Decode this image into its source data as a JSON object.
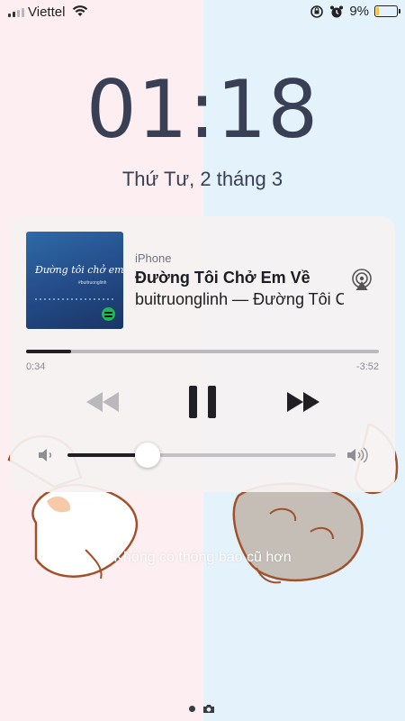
{
  "status_bar": {
    "carrier": "Viettel",
    "battery_percent": "9%",
    "battery_level": 0.09
  },
  "lock_screen": {
    "time": "01:18",
    "date": "Thứ Tư, 2 tháng 3",
    "notifications_text": "Không có thông báo cũ hơn"
  },
  "now_playing": {
    "source": "iPhone",
    "title": "Đường Tôi Chở Em Về",
    "subtitle": "buitruonglinh — Đường Tôi Chở Em Về",
    "elapsed": "0:34",
    "remaining": "-3:52",
    "progress": 0.128,
    "volume": 0.3,
    "artwork": {
      "title": "Đường tôi chở em về",
      "handle": "#buitruonglinh"
    }
  },
  "colors": {
    "bg_left": "#fdeef1",
    "bg_right": "#e4f2fb",
    "text_dark": "#394055",
    "artwork_blue": "#2f6aa8",
    "spotify_green": "#1db954",
    "battery_yellow": "#f3c33a"
  },
  "icons": {
    "airplay": "airplay-icon",
    "rewind": "rewind-icon",
    "pause": "pause-icon",
    "forward": "fast-forward-icon",
    "volume_low": "volume-low-icon",
    "volume_high": "volume-high-icon",
    "camera": "camera-icon",
    "spotify": "spotify-icon"
  }
}
